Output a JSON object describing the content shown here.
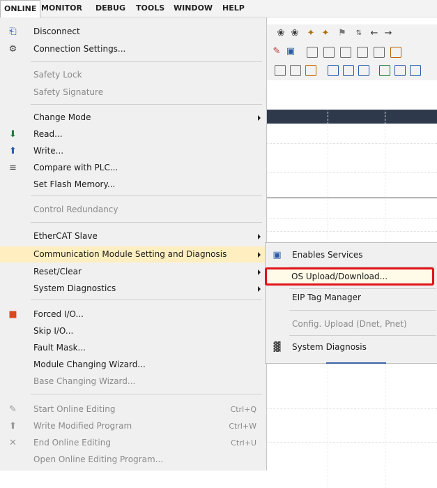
{
  "menubar": {
    "items": [
      "ONLINE",
      "MONITOR",
      "DEBUG",
      "TOOLS",
      "WINDOW",
      "HELP"
    ]
  },
  "online_menu": {
    "disconnect": "Disconnect",
    "connection_settings": "Connection Settings...",
    "safety_lock": "Safety Lock",
    "safety_signature": "Safety Signature",
    "change_mode": "Change Mode",
    "read": "Read...",
    "write": "Write...",
    "compare_with_plc": "Compare with PLC...",
    "set_flash_memory": "Set Flash Memory...",
    "control_redundancy": "Control Redundancy",
    "ethercat_slave": "EtherCAT Slave",
    "comm_module": "Communication Module Setting and Diagnosis",
    "reset_clear": "Reset/Clear",
    "system_diagnostics": "System Diagnostics",
    "forced_io": "Forced I/O...",
    "skip_io": "Skip I/O...",
    "fault_mask": "Fault Mask...",
    "module_changing_wizard": "Module Changing Wizard...",
    "base_changing_wizard": "Base Changing Wizard...",
    "start_online_editing": "Start Online Editing",
    "start_online_editing_shortcut": "Ctrl+Q",
    "write_modified_program": "Write Modified Program",
    "write_modified_program_shortcut": "Ctrl+W",
    "end_online_editing": "End Online Editing",
    "end_online_editing_shortcut": "Ctrl+U",
    "open_online_editing_program": "Open Online Editing Program..."
  },
  "submenu": {
    "enables_services": "Enables Services",
    "os_upload_download": "OS Upload/Download...",
    "eip_tag_manager": "EIP Tag Manager",
    "config_upload": "Config. Upload (Dnet, Pnet)",
    "system_diagnosis": "System Diagnosis"
  },
  "colors": {
    "highlight": "#ffefc0",
    "callout_border": "#e0141b",
    "titlebar": "#2e3a4c"
  }
}
